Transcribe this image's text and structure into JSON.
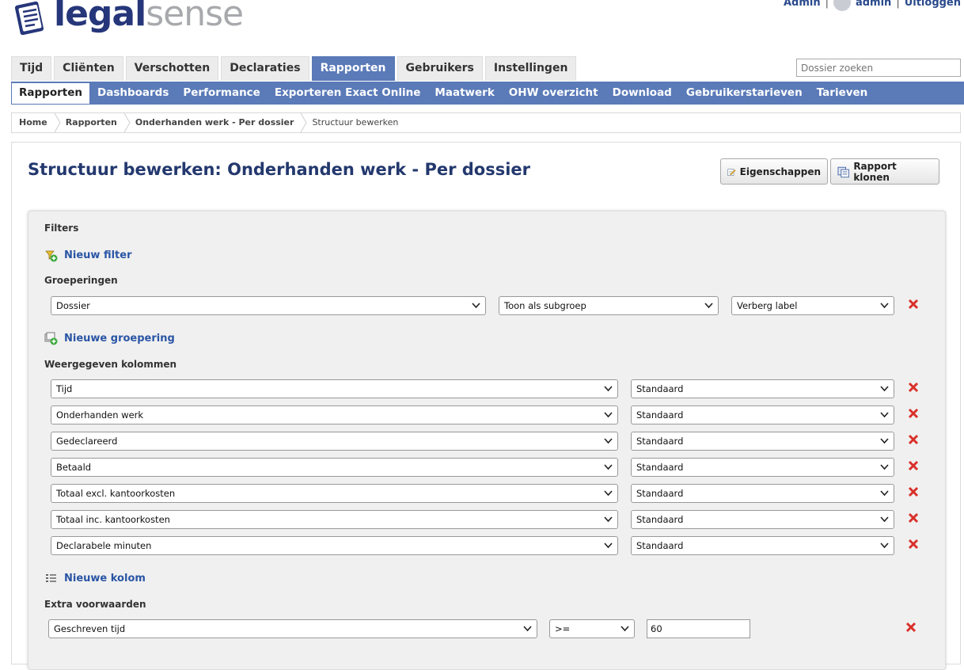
{
  "header": {
    "logo_part1": "legal",
    "logo_part2": "sense",
    "admin_link": "Admin",
    "separator": "|",
    "user_name": "admin",
    "logout": "Uitloggen"
  },
  "main_tabs": [
    "Tijd",
    "Cliënten",
    "Verschotten",
    "Declaraties",
    "Rapporten",
    "Gebruikers",
    "Instellingen"
  ],
  "main_tab_active": "Rapporten",
  "search": {
    "placeholder": "Dossier zoeken"
  },
  "sub_tabs": [
    "Rapporten",
    "Dashboards",
    "Performance",
    "Exporteren Exact Online",
    "Maatwerk",
    "OHW overzicht",
    "Download",
    "Gebruikerstarieven",
    "Tarieven"
  ],
  "breadcrumb": [
    "Home",
    "Rapporten",
    "Onderhanden werk - Per dossier",
    "Structuur bewerken"
  ],
  "page": {
    "title": "Structuur bewerken: Onderhanden werk - Per dossier",
    "btn_properties": "Eigenschappen",
    "btn_clone": "Rapport klonen"
  },
  "filters": {
    "label": "Filters",
    "new_filter": "Nieuw filter"
  },
  "groupings": {
    "label": "Groeperingen",
    "row": {
      "field": "Dossier",
      "display": "Toon als subgroep",
      "label_mode": "Verberg label"
    },
    "new_grouping": "Nieuwe groepering"
  },
  "columns": {
    "label": "Weergegeven kolommen",
    "rows": [
      {
        "field": "Tijd",
        "format": "Standaard"
      },
      {
        "field": "Onderhanden werk",
        "format": "Standaard"
      },
      {
        "field": "Gedeclareerd",
        "format": "Standaard"
      },
      {
        "field": "Betaald",
        "format": "Standaard"
      },
      {
        "field": "Totaal excl. kantoorkosten",
        "format": "Standaard"
      },
      {
        "field": "Totaal inc. kantoorkosten",
        "format": "Standaard"
      },
      {
        "field": "Declarabele minuten",
        "format": "Standaard"
      }
    ],
    "new_column": "Nieuwe kolom"
  },
  "extra": {
    "label": "Extra voorwaarden",
    "field": "Geschreven tijd",
    "operator": ">=",
    "value": "60"
  },
  "colors": {
    "nav_blue": "#5a7ab8",
    "title_blue": "#23386e",
    "link_blue": "#2a55a5",
    "delete_red": "#d9302a"
  }
}
